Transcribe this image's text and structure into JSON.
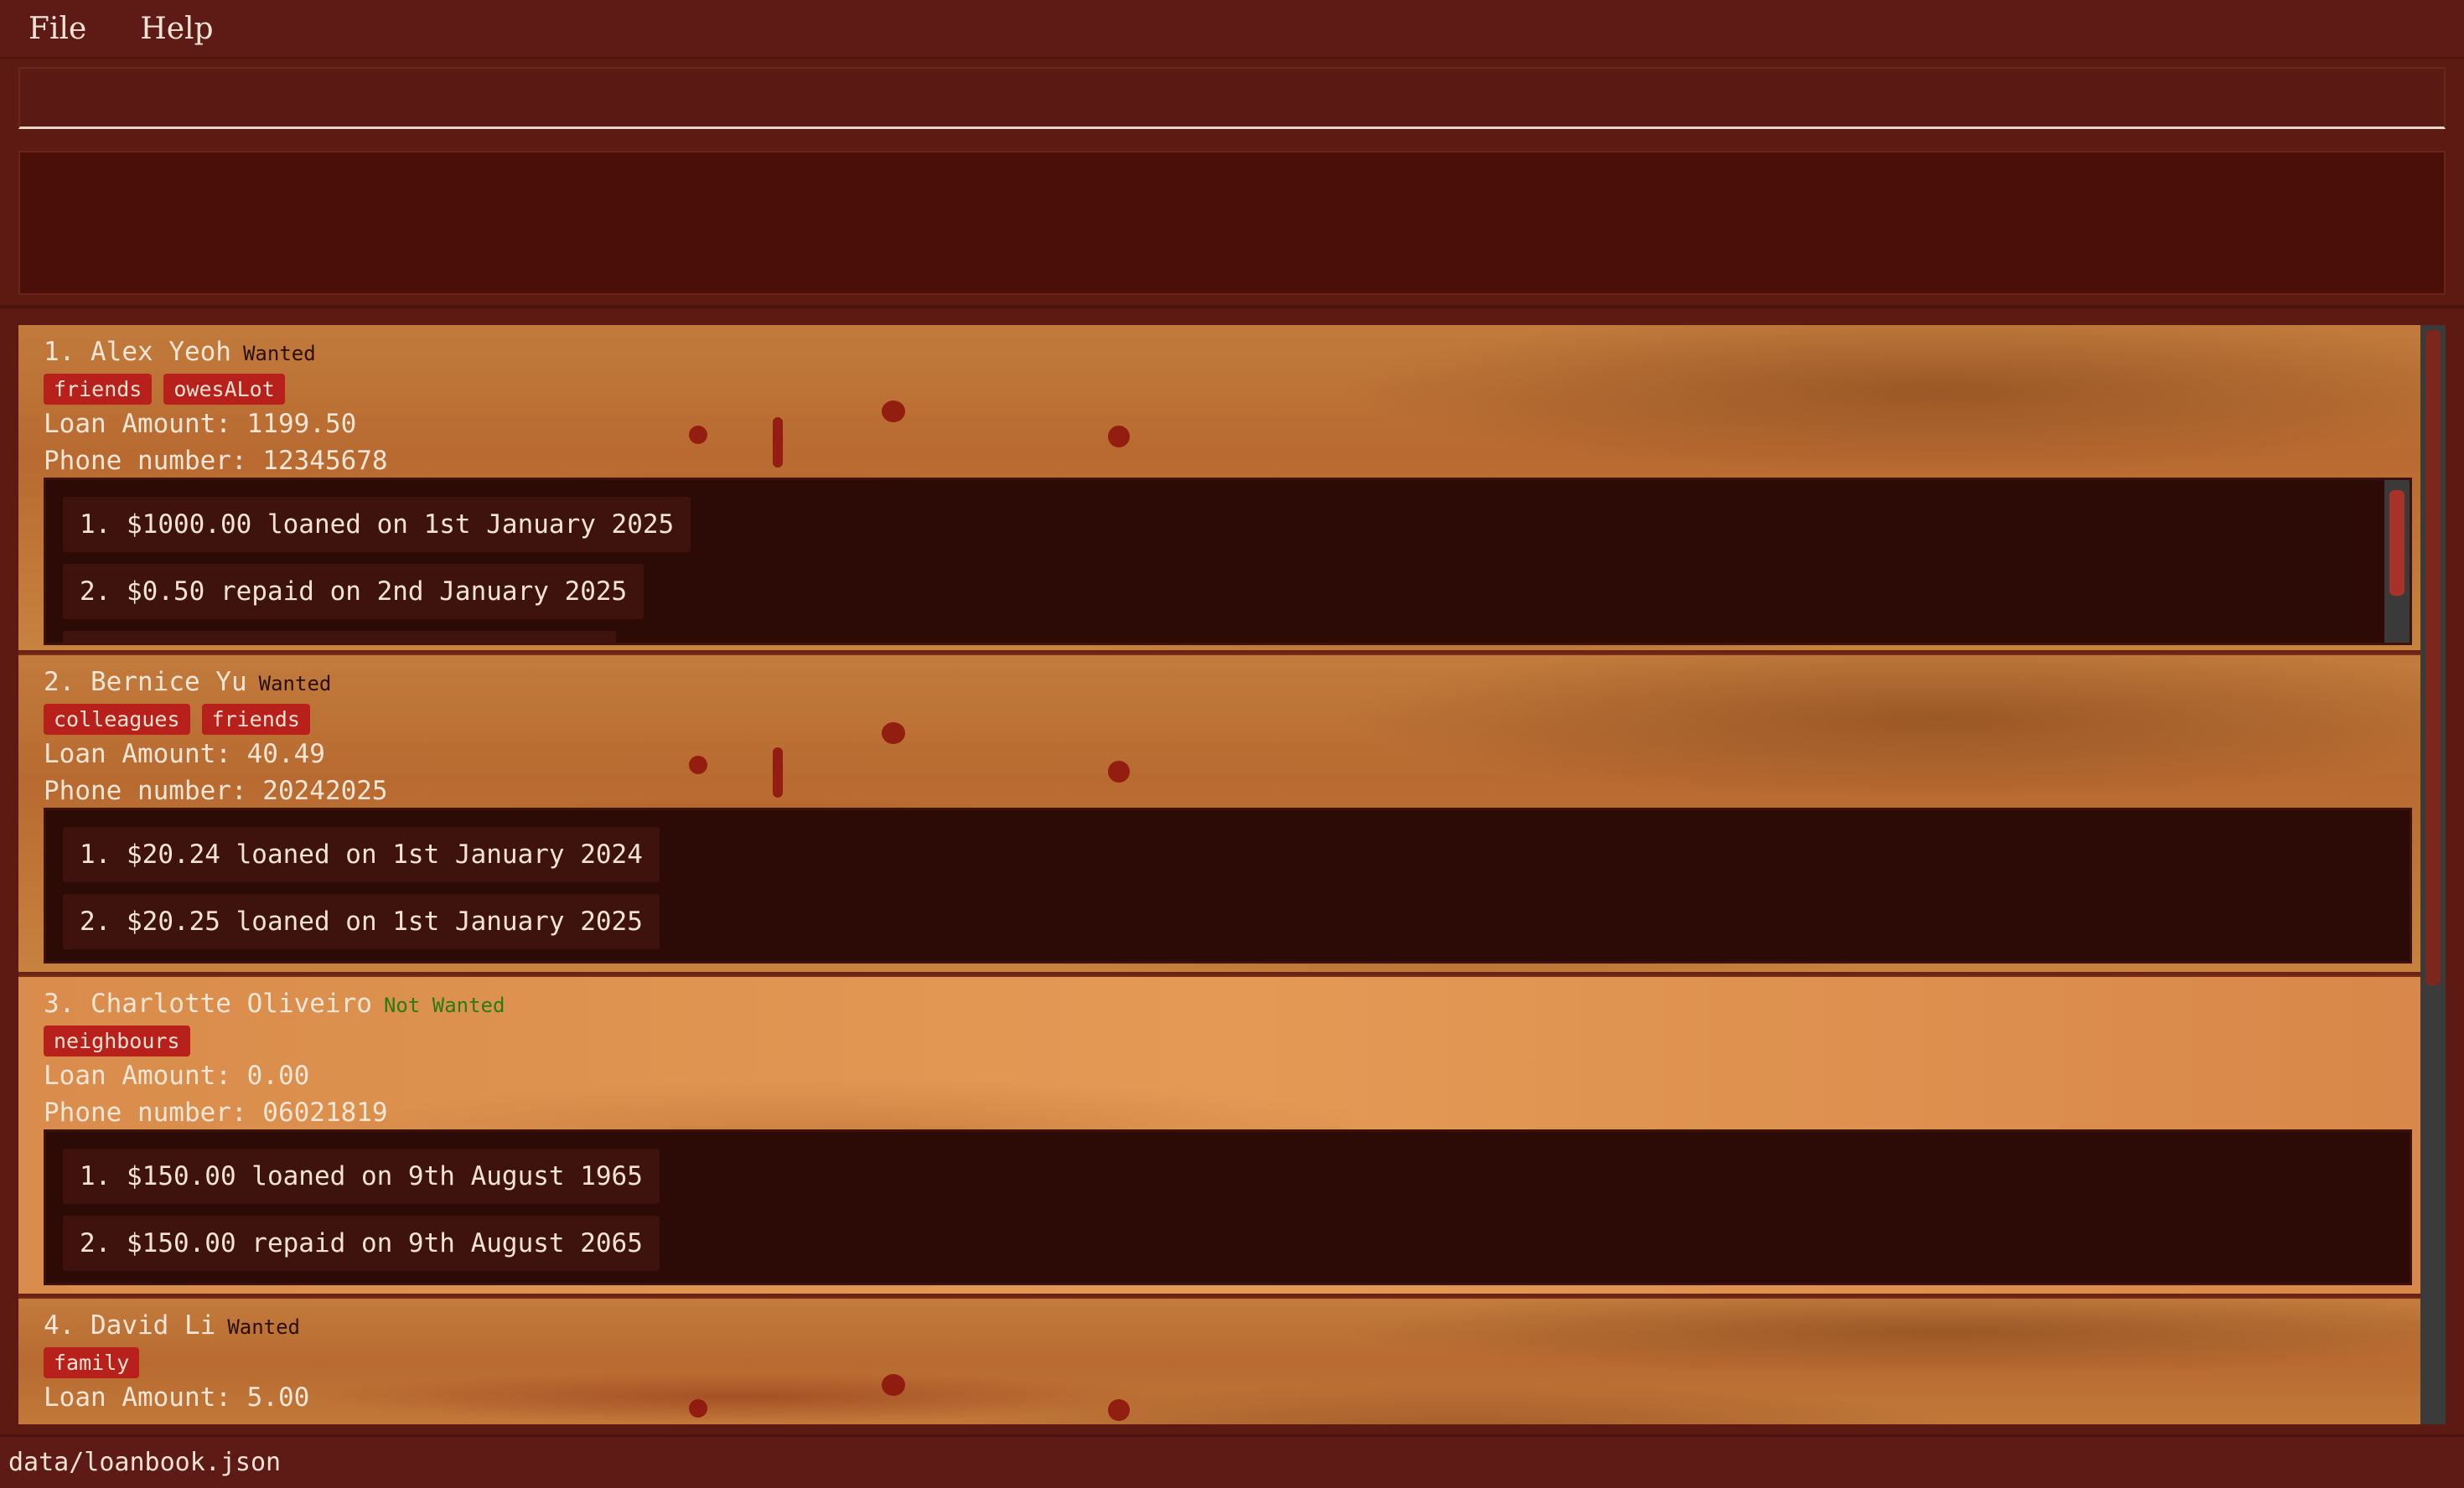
{
  "menu": {
    "file": "File",
    "help": "Help"
  },
  "command": {
    "value": "",
    "placeholder": ""
  },
  "result": {
    "text": ""
  },
  "persons": [
    {
      "index": "1.",
      "name": "Alex Yeoh",
      "status": "Wanted",
      "tags": [
        "friends",
        "owesALot"
      ],
      "loan_amount": "Loan Amount: 1199.50",
      "phone": "Phone number: 12345678",
      "loans": [
        "1. $1000.00 loaned on 1st January 2025",
        "2. $0.50 repaid on 2nd January 2025"
      ]
    },
    {
      "index": "2.",
      "name": "Bernice Yu",
      "status": "Wanted",
      "tags": [
        "colleagues",
        "friends"
      ],
      "loan_amount": "Loan Amount: 40.49",
      "phone": "Phone number: 20242025",
      "loans": [
        "1. $20.24 loaned on 1st January 2024",
        "2. $20.25 loaned on 1st January 2025"
      ]
    },
    {
      "index": "3.",
      "name": "Charlotte Oliveiro",
      "status": "Not Wanted",
      "tags": [
        "neighbours"
      ],
      "loan_amount": "Loan Amount: 0.00",
      "phone": "Phone number: 06021819",
      "loans": [
        "1. $150.00 loaned on 9th August 1965",
        "2. $150.00 repaid on 9th August 2065"
      ]
    },
    {
      "index": "4.",
      "name": "David Li",
      "status": "Wanted",
      "tags": [
        "family"
      ],
      "loan_amount": "Loan Amount: 5.00"
    }
  ],
  "status_bar": {
    "path": "data/loanbook.json"
  },
  "colors": {
    "background": "#5c1a13",
    "tag": "#b8201c",
    "card": "#c27b3c",
    "loan_panel": "#2c0a06",
    "not_wanted": "#2b7a13"
  }
}
